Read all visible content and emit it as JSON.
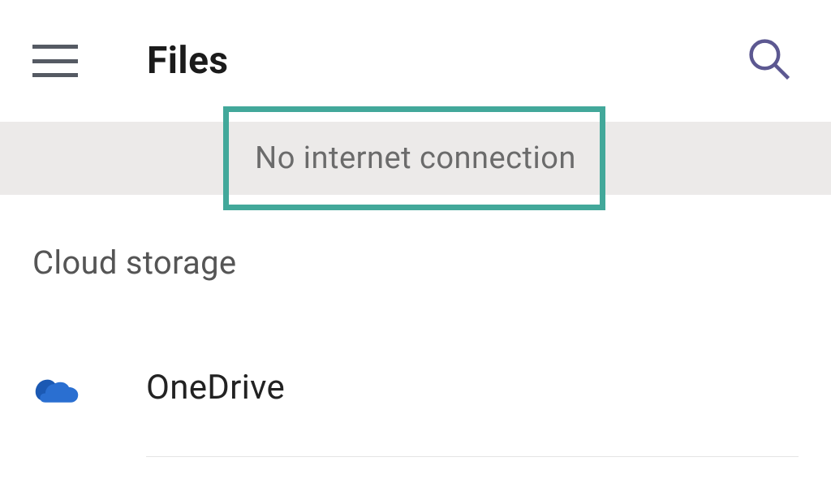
{
  "header": {
    "title": "Files"
  },
  "banner": {
    "text": "No internet connection"
  },
  "section": {
    "title": "Cloud storage",
    "items": [
      {
        "icon": "onedrive-icon",
        "label": "OneDrive"
      }
    ]
  },
  "colors": {
    "highlight": "#42a89a",
    "banner_bg": "#eceae9",
    "icon_primary": "#1b59b3"
  }
}
